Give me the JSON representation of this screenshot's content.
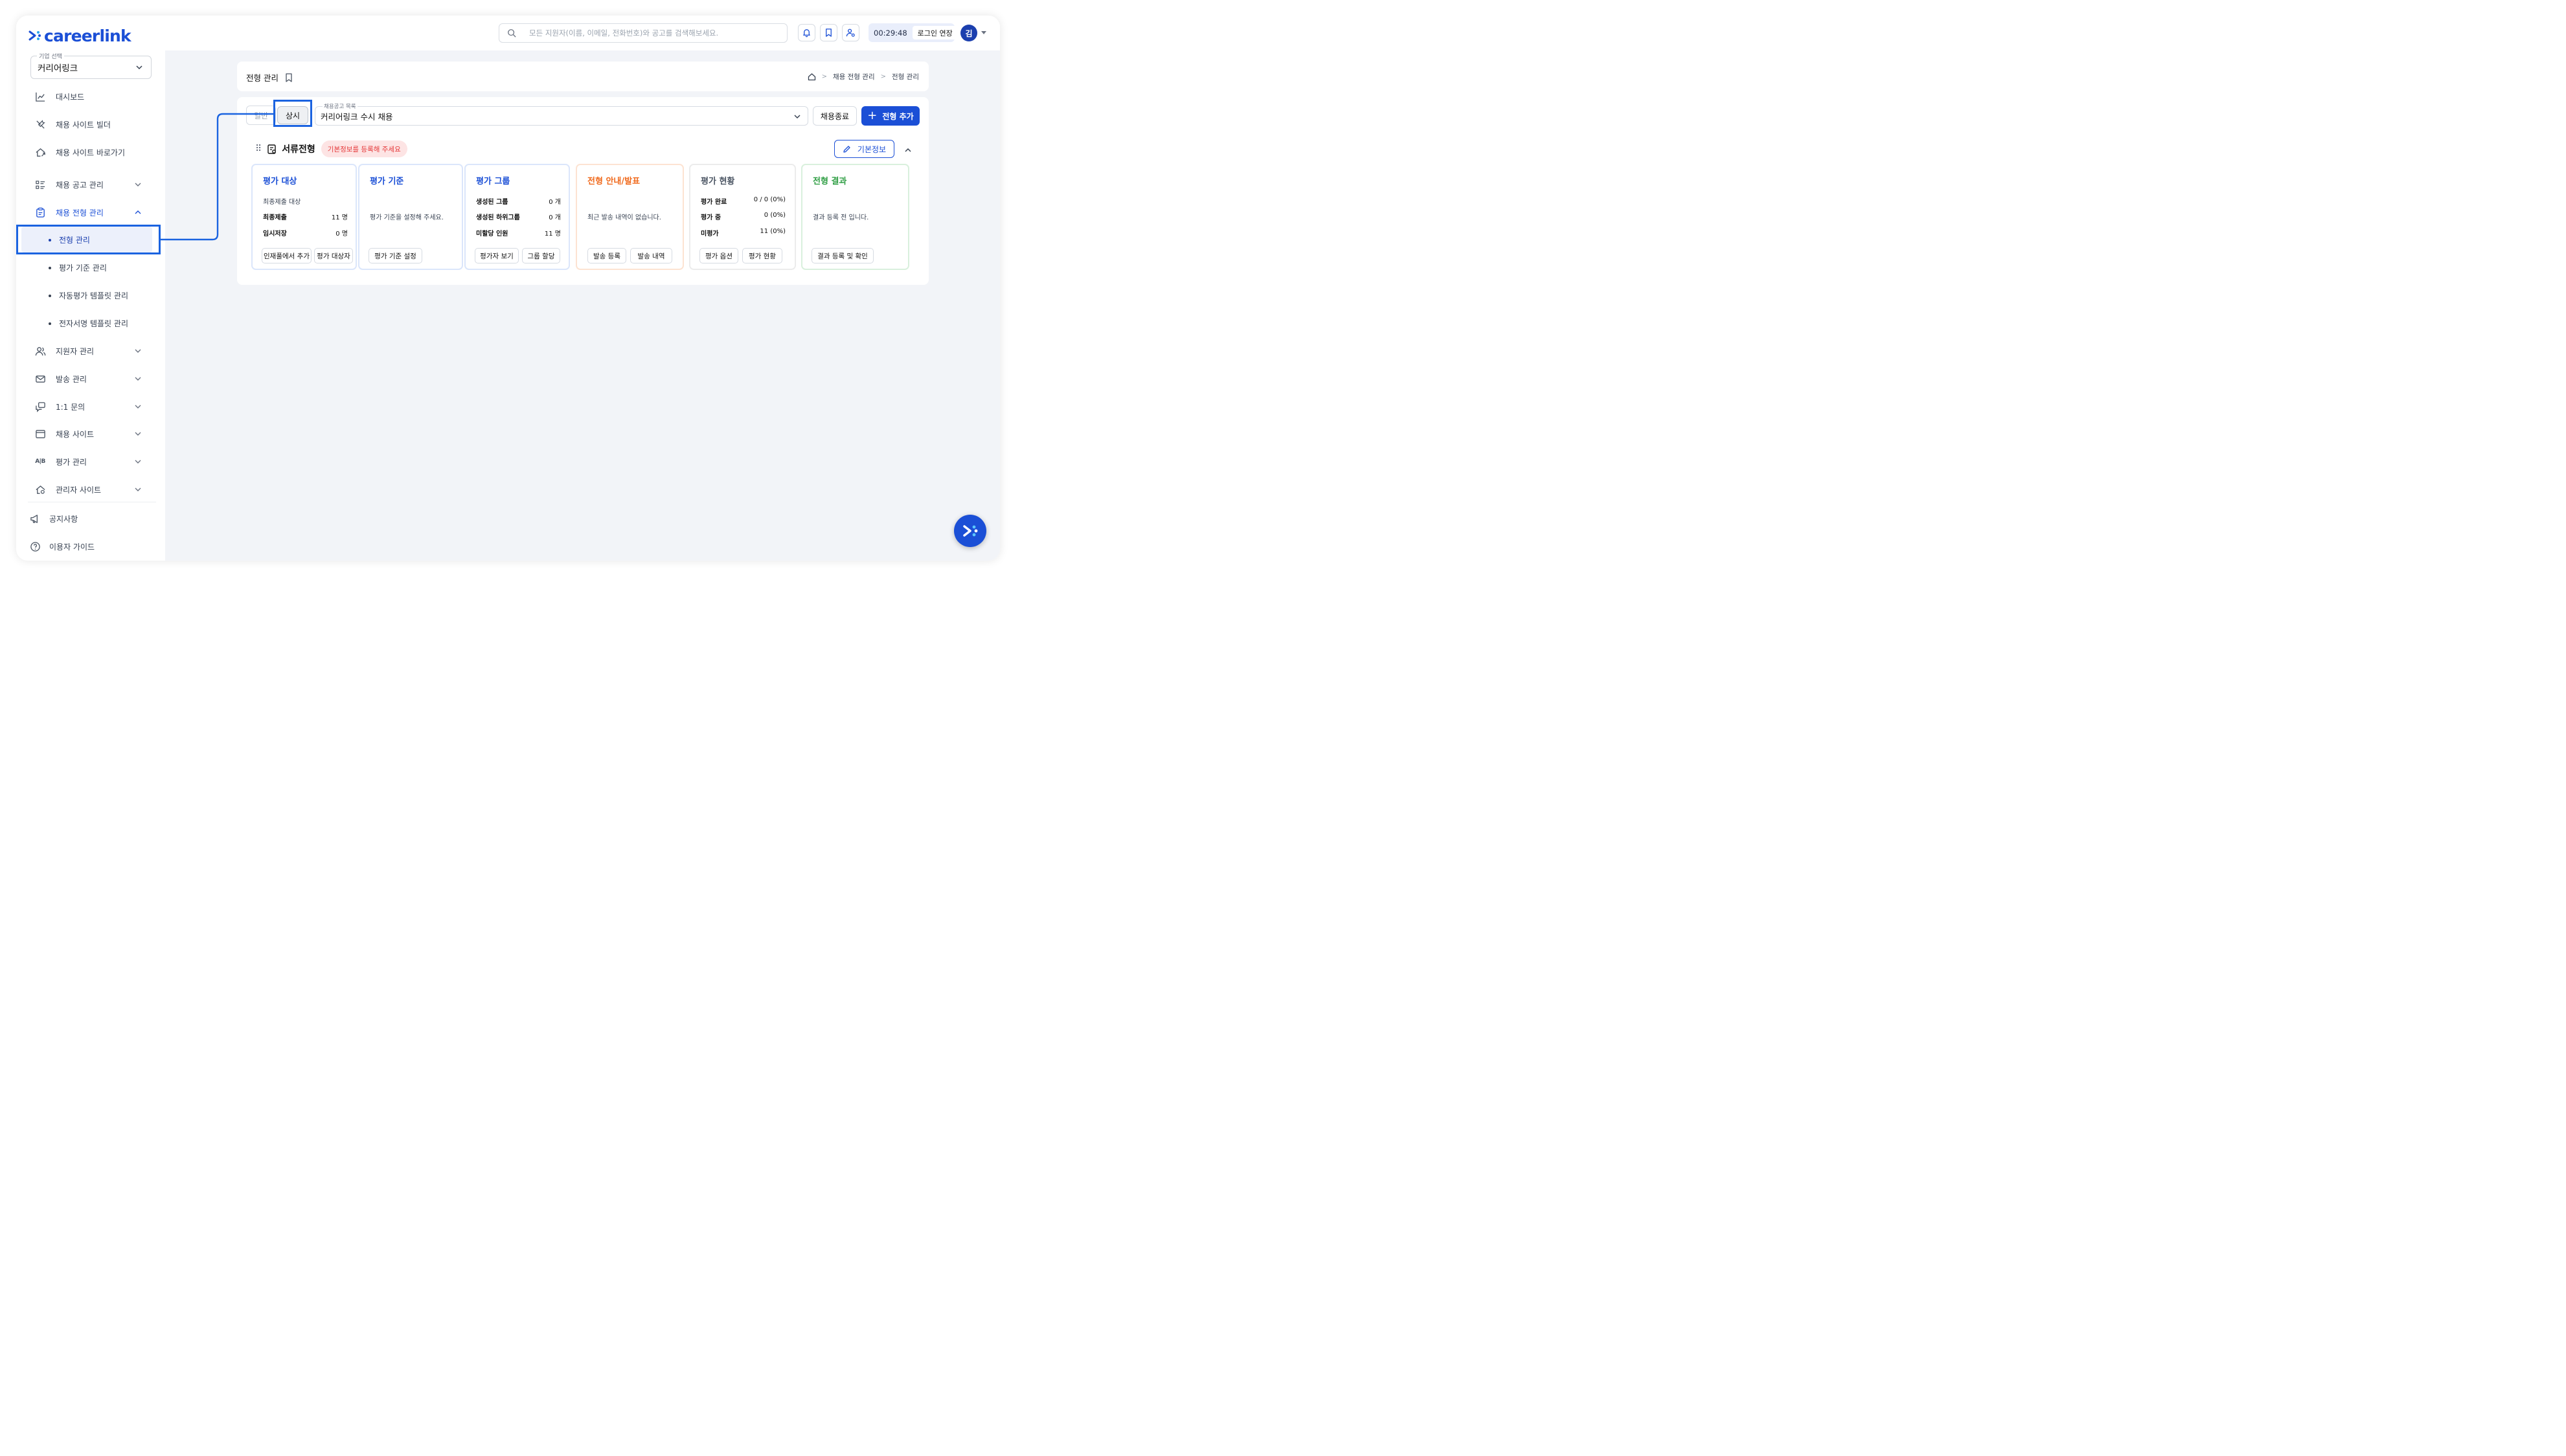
{
  "brand": {
    "logo_text": "careerlink",
    "accent": "#1b4fd6",
    "highlight": "#1b63e0"
  },
  "header": {
    "search_placeholder": "모든 지원자(이름, 이메일, 전화번호)와 공고를 검색해보세요.",
    "timer": "00:29:48",
    "extend_label": "로그인 연장",
    "avatar_initial": "김",
    "icons": [
      "bell-icon",
      "bookmark-icon",
      "user-settings-icon"
    ]
  },
  "sidebar": {
    "company_label": "기업 선택",
    "company_value": "커리어링크",
    "items": [
      {
        "label": "대시보드",
        "icon": "dashboard-chart-icon"
      },
      {
        "label": "채용 사이트 빌더",
        "icon": "tools-icon"
      },
      {
        "label": "채용 사이트 바로가기",
        "icon": "home-link-icon"
      },
      {
        "label": "채용 공고 관리",
        "icon": "list-icon"
      },
      {
        "label": "채용 전형 관리",
        "icon": "clipboard-icon"
      },
      {
        "label": "지원자 관리",
        "icon": "users-icon"
      },
      {
        "label": "발송 관리",
        "icon": "mail-icon"
      },
      {
        "label": "1:1 문의",
        "icon": "chat-icon"
      },
      {
        "label": "채용 사이트",
        "icon": "window-icon"
      },
      {
        "label": "평가 관리",
        "icon": "ab-icon"
      },
      {
        "label": "관리자 사이트",
        "icon": "admin-home-icon"
      }
    ],
    "sub_items": [
      "전형 관리",
      "평가 기준 관리",
      "자동평가 템플릿 관리",
      "전자서명 템플릿 관리"
    ],
    "footer": [
      {
        "label": "공지사항",
        "icon": "megaphone-icon"
      },
      {
        "label": "이용자 가이드",
        "icon": "help-icon"
      }
    ]
  },
  "page": {
    "title": "전형 관리",
    "breadcrumb": [
      "채용 전형 관리",
      "전형 관리"
    ]
  },
  "toolbar": {
    "tab_general": "일반",
    "tab_permanent": "상시",
    "posting_label": "채용공고 목록",
    "posting_value": "커리어링크 수시 채용",
    "end_label": "채용종료",
    "add_label": "전형 추가"
  },
  "stage": {
    "title": "서류전형",
    "warning": "기본정보를 등록해 주세요",
    "info_button": "기본정보",
    "panels": [
      {
        "title": "평가 대상",
        "color": "#1b4fd6",
        "subtitle": "최종제출 대상",
        "rows": [
          {
            "k": "최종제출",
            "v": "11 명"
          },
          {
            "k": "임시저장",
            "v": "0 명"
          }
        ],
        "buttons": [
          "인재풀에서 추가",
          "평가 대상자"
        ]
      },
      {
        "title": "평가 기준",
        "color": "#1b4fd6",
        "message": "평가 기준을 설정해 주세요.",
        "buttons": [
          "평가 기준 설정"
        ]
      },
      {
        "title": "평가 그룹",
        "color": "#1b4fd6",
        "rows": [
          {
            "k": "생성된 그룹",
            "v": "0 개"
          },
          {
            "k": "생성된 하위그룹",
            "v": "0 개"
          },
          {
            "k": "미할당 인원",
            "v": "11 명"
          }
        ],
        "buttons": [
          "평가자 보기",
          "그룹 할당"
        ]
      },
      {
        "title": "전형 안내/발표",
        "color": "#f06a1d",
        "message": "최근 발송 내역이 없습니다.",
        "buttons": [
          "발송 등록",
          "발송 내역"
        ]
      },
      {
        "title": "평가 현황",
        "color": "#4b5563",
        "rows": [
          {
            "k": "평가 완료",
            "v": "0 / 0 (0%)"
          },
          {
            "k": "평가 중",
            "v": "0 (0%)"
          },
          {
            "k": "미평가",
            "v": "11 (0%)"
          }
        ],
        "buttons": [
          "평가 옵션",
          "평가 현황"
        ]
      },
      {
        "title": "전형 결과",
        "color": "#2f9e44",
        "message": "결과 등록 전 입니다.",
        "buttons": [
          "결과 등록 및 확인"
        ]
      }
    ]
  }
}
